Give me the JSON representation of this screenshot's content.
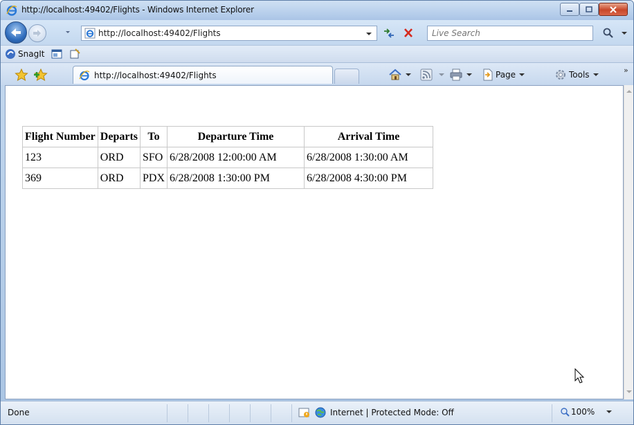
{
  "window": {
    "title": "http://localhost:49402/Flights - Windows Internet Explorer"
  },
  "address_bar": {
    "url": "http://localhost:49402/Flights"
  },
  "search": {
    "placeholder": "Live Search"
  },
  "links_bar": {
    "snagit_label": "SnagIt"
  },
  "tab": {
    "label": "http://localhost:49402/Flights"
  },
  "command_bar": {
    "page_label": "Page",
    "tools_label": "Tools"
  },
  "table": {
    "headers": [
      "Flight Number",
      "Departs",
      "To",
      "Departure Time",
      "Arrival Time"
    ],
    "rows": [
      [
        "123",
        "ORD",
        "SFO",
        "6/28/2008 12:00:00 AM",
        "6/28/2008 1:30:00 AM"
      ],
      [
        "369",
        "ORD",
        "PDX",
        "6/28/2008 1:30:00 PM",
        "6/28/2008 4:30:00 PM"
      ]
    ]
  },
  "status_bar": {
    "status": "Done",
    "zone": "Internet | Protected Mode: Off",
    "zoom": "100%"
  },
  "colors": {
    "frame": "#a9c4e3",
    "close_button": "#c8472a",
    "ie_blue": "#2f6dbd"
  }
}
